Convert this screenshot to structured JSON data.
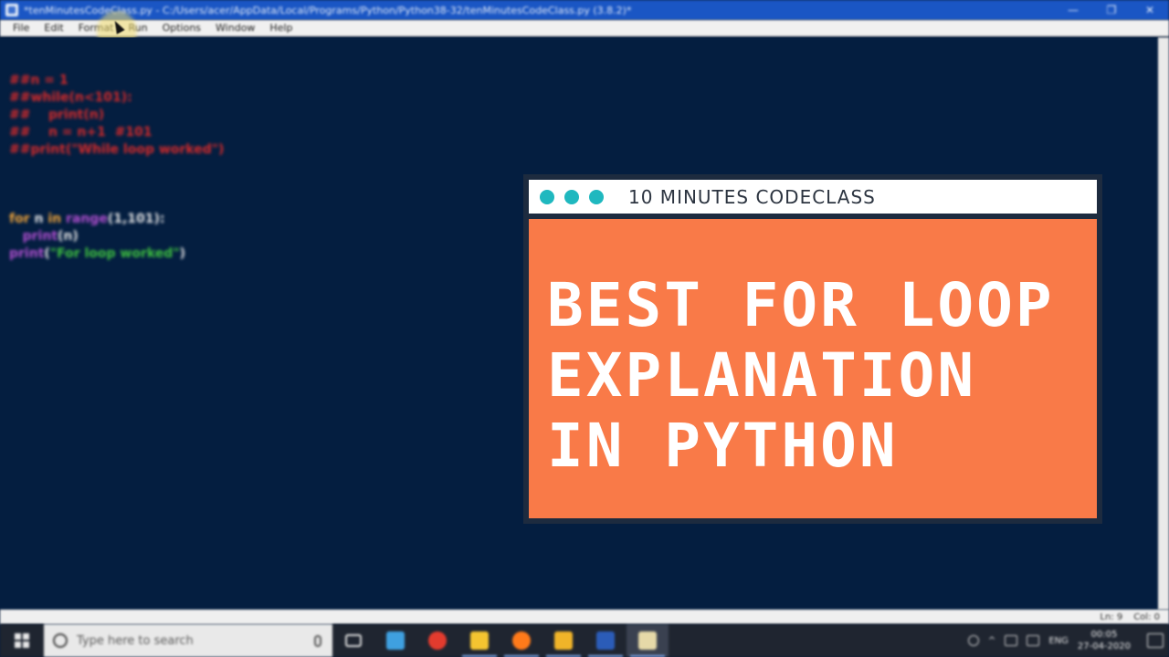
{
  "window": {
    "title": "*tenMinutesCodeClass.py - C:/Users/acer/AppData/Local/Programs/Python/Python38-32/tenMinutesCodeClass.py (3.8.2)*",
    "minimize": "—",
    "maximize": "❐",
    "close": "✕"
  },
  "menu": {
    "items": [
      "File",
      "Edit",
      "Format",
      "Run",
      "Options",
      "Window",
      "Help"
    ]
  },
  "code": {
    "comment_lines": [
      "##n = 1",
      "##while(n<101):",
      "##    print(n)",
      "##    n = n+1  #101",
      "##print(\"While loop worked\")"
    ],
    "for_kw": "for",
    "for_var": " n ",
    "in_kw": "in",
    "range_fn": " range",
    "range_args": "(1,101):",
    "indent": "   ",
    "print_fn": "print",
    "print_args": "(n)",
    "print_fn2": "print",
    "open_paren": "(",
    "print_str": "\"For loop worked\"",
    "close_paren": ")"
  },
  "statusbar": {
    "ln": "Ln: 9",
    "col": "Col: 0"
  },
  "taskbar": {
    "search_placeholder": "Type here to search",
    "tray_lang": "ENG",
    "time": "00:05",
    "date": "27-04-2020",
    "icon_colors": [
      "#3fa0e0",
      "#e33b2e",
      "#f4c430",
      "#ff7a1a",
      "#f0b429",
      "#2b5cb8",
      "#e6d9a8"
    ]
  },
  "card": {
    "brand": "10 MINUTES CODECLASS",
    "title": "BEST FOR LOOP EXPLANATION IN PYTHON",
    "accent_color": "#f97a48",
    "dot_color": "#1fb8bf"
  }
}
